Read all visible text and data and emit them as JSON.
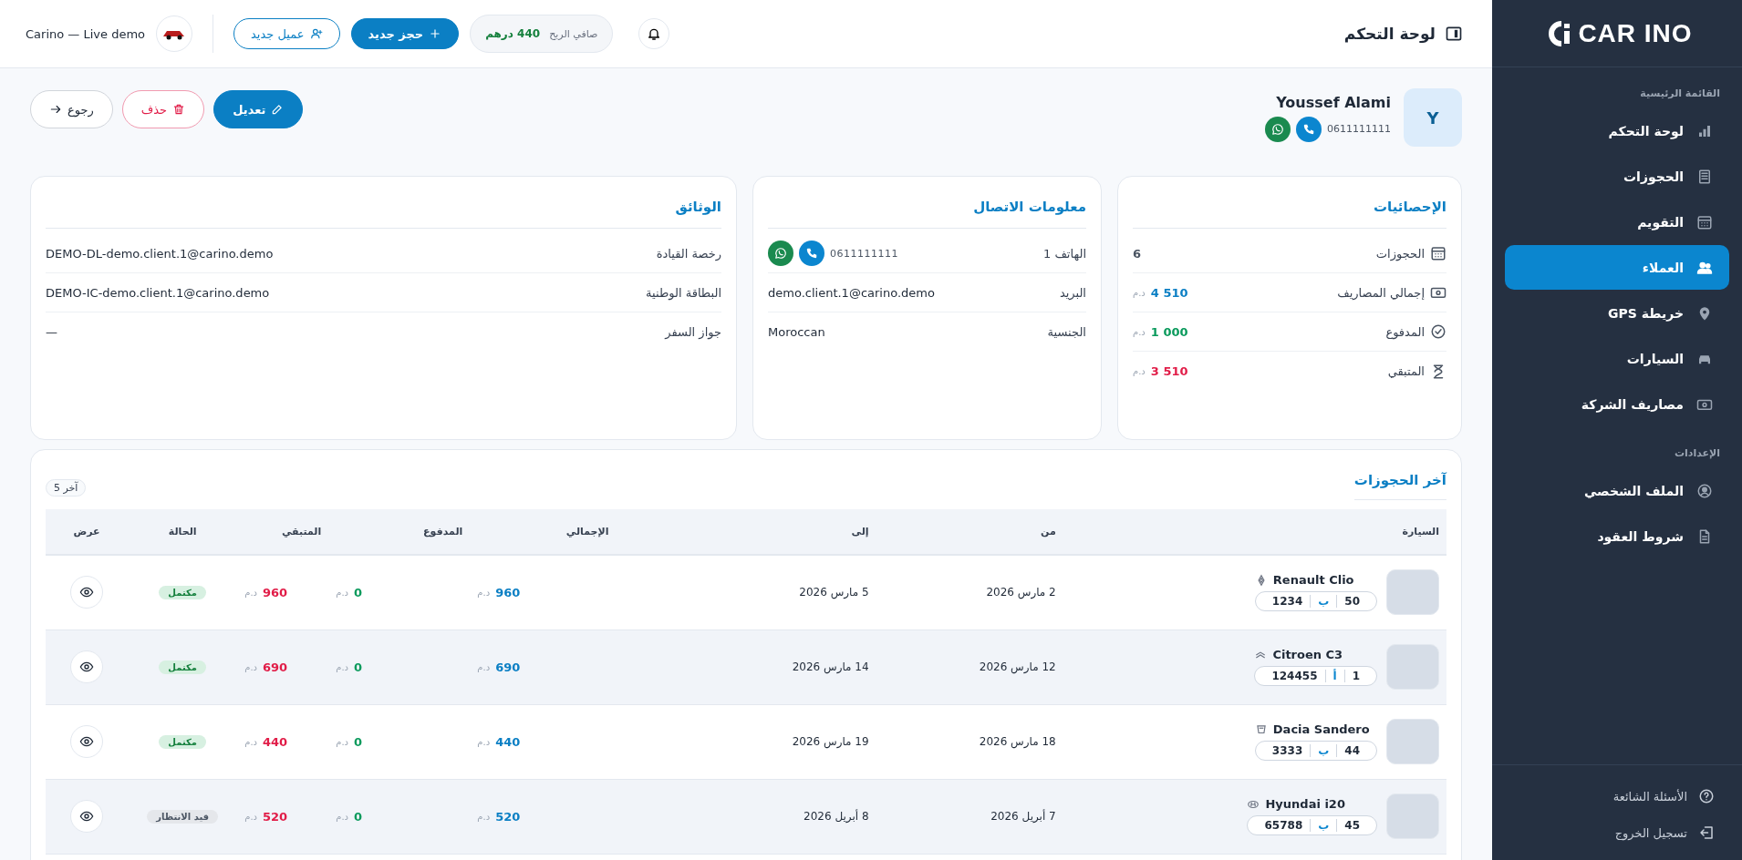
{
  "sidebar": {
    "logo": "CAR INO",
    "sections": [
      {
        "title": "القائمة الرئيسية",
        "items": [
          {
            "label": "لوحة التحكم",
            "selected": false
          },
          {
            "label": "الحجوزات",
            "selected": false
          },
          {
            "label": "التقويم",
            "selected": false
          },
          {
            "label": "العملاء",
            "selected": true
          },
          {
            "label": "خريطة GPS",
            "selected": false
          },
          {
            "label": "السيارات",
            "selected": false
          },
          {
            "label": "مصاريف الشركة",
            "selected": false
          }
        ]
      },
      {
        "title": "الإعدادات",
        "items": [
          {
            "label": "الملف الشخصي",
            "selected": false
          },
          {
            "label": "شروط العقود",
            "selected": false
          }
        ]
      }
    ],
    "footer_items": [
      {
        "label": "الأسئلة الشائعة"
      },
      {
        "label": "تسجيل الخروج"
      }
    ]
  },
  "topbar": {
    "title": "لوحة التحكم",
    "profit_label": "صافي الربح",
    "profit_value": "440 درهم",
    "new_booking": "حجز جديد",
    "new_client": "عميل جديد",
    "company": "Carino — Live demo"
  },
  "client": {
    "initial": "Y",
    "name": "Youssef Alami",
    "phone": "0611111111",
    "actions": [
      {
        "label": "تعديل",
        "kind": "edit"
      },
      {
        "label": "حذف",
        "kind": "delete"
      },
      {
        "label": "رجوع",
        "kind": "back"
      }
    ]
  },
  "stats": {
    "title": "الإحصائيات",
    "rows": [
      {
        "label": "الحجوزات",
        "value": "6",
        "kind": "count"
      },
      {
        "label": "إجمالي المصاريف",
        "value": "4 510",
        "unit": "د.م",
        "kind": "total"
      },
      {
        "label": "المدفوع",
        "value": "1 000",
        "unit": "د.م",
        "kind": "paid"
      },
      {
        "label": "المتبقي",
        "value": "3 510",
        "unit": "د.م",
        "kind": "due"
      }
    ]
  },
  "contact": {
    "title": "معلومات الاتصال",
    "rows": [
      {
        "label": "الهاتف 1",
        "value": "0611111111",
        "kind": "phone"
      },
      {
        "label": "البريد",
        "value": "demo.client.1@carino.demo",
        "kind": "text"
      },
      {
        "label": "الجنسية",
        "value": "Moroccan",
        "kind": "text"
      }
    ]
  },
  "documents": {
    "title": "الوثائق",
    "rows": [
      {
        "label": "رخصة القيادة",
        "value": "DEMO-DL-demo.client.1@carino.demo",
        "kind": "text"
      },
      {
        "label": "البطاقة الوطنية",
        "value": "DEMO-IC-demo.client.1@carino.demo",
        "kind": "text"
      },
      {
        "label": "جواز السفر",
        "value": "—",
        "kind": "text"
      }
    ]
  },
  "bookings": {
    "title": "آخر الحجوزات",
    "badge": "آخر 5",
    "columns": [
      "السيارة",
      "من",
      "إلى",
      "الإجمالي",
      "المدفوع",
      "المتبقي",
      "الحالة",
      "عرض"
    ],
    "rows": [
      {
        "car": "Renault Clio",
        "plate": [
          "50",
          "ب",
          "1234"
        ],
        "from": "2 مارس 2026",
        "to": "5 مارس 2026",
        "amounts": [
          {
            "value": "960",
            "unit": "د.م",
            "kind": "total"
          },
          {
            "value": "0",
            "unit": "د.م",
            "kind": "paid"
          },
          {
            "value": "960",
            "unit": "د.م",
            "kind": "due"
          }
        ],
        "status": {
          "label": "مكتمل",
          "kind": "done"
        }
      },
      {
        "car": "Citroen C3",
        "plate": [
          "1",
          "أ",
          "124455"
        ],
        "from": "12 مارس 2026",
        "to": "14 مارس 2026",
        "amounts": [
          {
            "value": "690",
            "unit": "د.م",
            "kind": "total"
          },
          {
            "value": "0",
            "unit": "د.م",
            "kind": "paid"
          },
          {
            "value": "690",
            "unit": "د.م",
            "kind": "due"
          }
        ],
        "status": {
          "label": "مكتمل",
          "kind": "done"
        }
      },
      {
        "car": "Dacia Sandero",
        "plate": [
          "44",
          "ب",
          "3333"
        ],
        "from": "18 مارس 2026",
        "to": "19 مارس 2026",
        "amounts": [
          {
            "value": "440",
            "unit": "د.م",
            "kind": "total"
          },
          {
            "value": "0",
            "unit": "د.م",
            "kind": "paid"
          },
          {
            "value": "440",
            "unit": "د.م",
            "kind": "due"
          }
        ],
        "status": {
          "label": "مكتمل",
          "kind": "done"
        }
      },
      {
        "car": "Hyundai i20",
        "plate": [
          "45",
          "ب",
          "65788"
        ],
        "from": "7 أبريل 2026",
        "to": "8 أبريل 2026",
        "amounts": [
          {
            "value": "520",
            "unit": "د.م",
            "kind": "total"
          },
          {
            "value": "0",
            "unit": "د.م",
            "kind": "paid"
          },
          {
            "value": "520",
            "unit": "د.م",
            "kind": "due"
          }
        ],
        "status": {
          "label": "قيد الانتظار",
          "kind": "pending"
        }
      }
    ]
  }
}
